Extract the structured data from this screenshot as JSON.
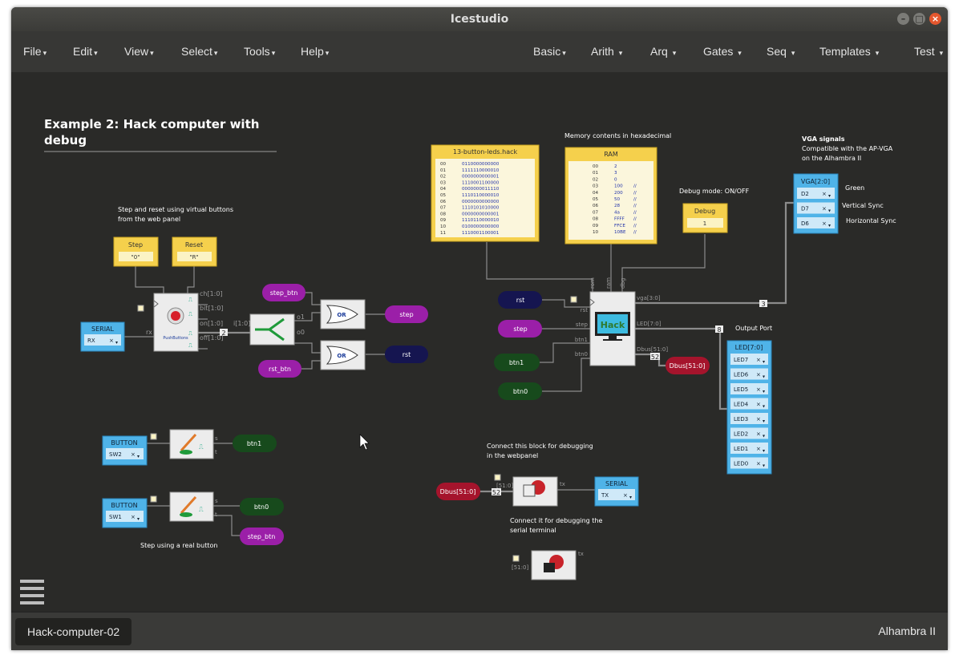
{
  "window": {
    "title": "Icestudio"
  },
  "menus_left": [
    {
      "label": "File",
      "caret": "▾"
    },
    {
      "label": "Edit",
      "caret": "▾"
    },
    {
      "label": "View",
      "caret": "▾"
    },
    {
      "label": "Select",
      "caret": "▾"
    },
    {
      "label": "Tools",
      "caret": "▾"
    },
    {
      "label": "Help",
      "caret": "▾"
    }
  ],
  "menus_right": [
    {
      "label": "Basic",
      "caret": "▾"
    },
    {
      "label": "Arith",
      "caret": "▾"
    },
    {
      "label": "Arq",
      "caret": "▾"
    },
    {
      "label": "Gates",
      "caret": "▾"
    },
    {
      "label": "Seq",
      "caret": "▾"
    },
    {
      "label": "Templates",
      "caret": "▾"
    },
    {
      "label": "Test",
      "caret": "▾"
    }
  ],
  "canvas": {
    "heading_line1": "Example 2: Hack computer with",
    "heading_line2": "debug",
    "note_virtual_1": "Step and reset using virtual buttons",
    "note_virtual_2": "from the web panel",
    "note_memory": "Memory contents in hexadecimal",
    "note_debug_mode": "Debug mode: ON/OFF",
    "note_vga_title": "VGA signals",
    "note_vga_1": "Compatible with the AP-VGA",
    "note_vga_2": "on the Alhambra II",
    "note_green": "Green",
    "note_vsync": "Vertical Sync",
    "note_hsync": "Horizontal Sync",
    "note_output_port": "Output Port",
    "note_connect_1": "Connect this block for debugging",
    "note_connect_2": "in the webpanel",
    "note_serial_1": "Connect it for debugging the",
    "note_serial_2": "serial terminal",
    "note_real_button": "Step using a real button",
    "step_block": {
      "title": "Step",
      "value": "\"0\""
    },
    "reset_block": {
      "title": "Reset",
      "value": "\"R\""
    },
    "serial_rx": {
      "title": "SERIAL",
      "pin": "RX"
    },
    "serial_tx": {
      "title": "SERIAL",
      "pin": "TX"
    },
    "pushbuttons": {
      "label": "PushButtons",
      "ports": [
        "ch[1:0]",
        "bit[1:0]",
        "on[1:0]",
        "off[1:0]"
      ],
      "rx": "rx"
    },
    "splitter": {
      "in": "i[1:0]",
      "o1": "o1",
      "o0": "o0",
      "bus": "2"
    },
    "or_label": "OR",
    "hack_label": "Hack",
    "hack_ports_in": [
      "rom",
      "ram",
      "dbg",
      "rst",
      "step",
      "btn1",
      "btn0"
    ],
    "hack_ports_out": [
      "vga[3:0]",
      "LED[7:0]",
      "Dbus[51:0]"
    ],
    "bus_sizes": {
      "vga": "3",
      "led": "8",
      "dbus": "52"
    },
    "rom": {
      "title": "13-button-leds.hack",
      "rows": [
        [
          "00",
          "0110000000000"
        ],
        [
          "01",
          "1111110000010"
        ],
        [
          "02",
          "0000000000001"
        ],
        [
          "03",
          "1110001100000"
        ],
        [
          "04",
          "0000000011110"
        ],
        [
          "05",
          "1110110000010"
        ],
        [
          "06",
          "0000000000000"
        ],
        [
          "07",
          "1110101010000"
        ],
        [
          "08",
          "0000000000001"
        ],
        [
          "09",
          "1110110000010"
        ],
        [
          "10",
          "0100000000000"
        ],
        [
          "11",
          "1110001100001"
        ]
      ]
    },
    "ram": {
      "title": "RAM",
      "rows": [
        [
          "00",
          "2",
          ""
        ],
        [
          "01",
          "3",
          ""
        ],
        [
          "02",
          "0",
          ""
        ],
        [
          "03",
          "100",
          "//"
        ],
        [
          "04",
          "200",
          "//"
        ],
        [
          "05",
          "50",
          "//"
        ],
        [
          "06",
          "28",
          "//"
        ],
        [
          "07",
          "4a",
          "//"
        ],
        [
          "08",
          "FFFF",
          "//"
        ],
        [
          "09",
          "FFCE",
          "//"
        ],
        [
          "10",
          "10BE",
          "//"
        ]
      ]
    },
    "debug_const": {
      "title": "Debug",
      "value": "1"
    },
    "vga": {
      "title": "VGA[2:0]",
      "pins": [
        "D2",
        "D7",
        "D6"
      ]
    },
    "leds": {
      "title": "LED[7:0]",
      "pins": [
        "LED7",
        "LED6",
        "LED5",
        "LED4",
        "LED3",
        "LED2",
        "LED1",
        "LED0"
      ]
    },
    "labels": {
      "step_btn": "step_btn",
      "rst_btn": "rst_btn",
      "step": "step",
      "rst": "rst",
      "btn1": "btn1",
      "btn0": "btn0",
      "dbus": "Dbus[51:0]"
    },
    "button_sw2": {
      "title": "BUTTON",
      "pin": "SW2"
    },
    "button_sw1": {
      "title": "BUTTON",
      "pin": "SW1"
    },
    "debug_block_label": "[51:0]",
    "tx_label": "tx",
    "remove_x": "×",
    "dropdown_caret": "▾"
  },
  "footer": {
    "project": "Hack-computer-02",
    "board": "Alhambra II"
  },
  "colors": {
    "canvas": "#2a2a28",
    "yellow_block": "#f5d04c",
    "blue_block": "#4fb3e8",
    "purple_label": "#9b1fa8",
    "navy_label": "#151550",
    "green_label": "#174a1c",
    "red_label": "#a5142c",
    "wire": "#8c8c8c"
  }
}
